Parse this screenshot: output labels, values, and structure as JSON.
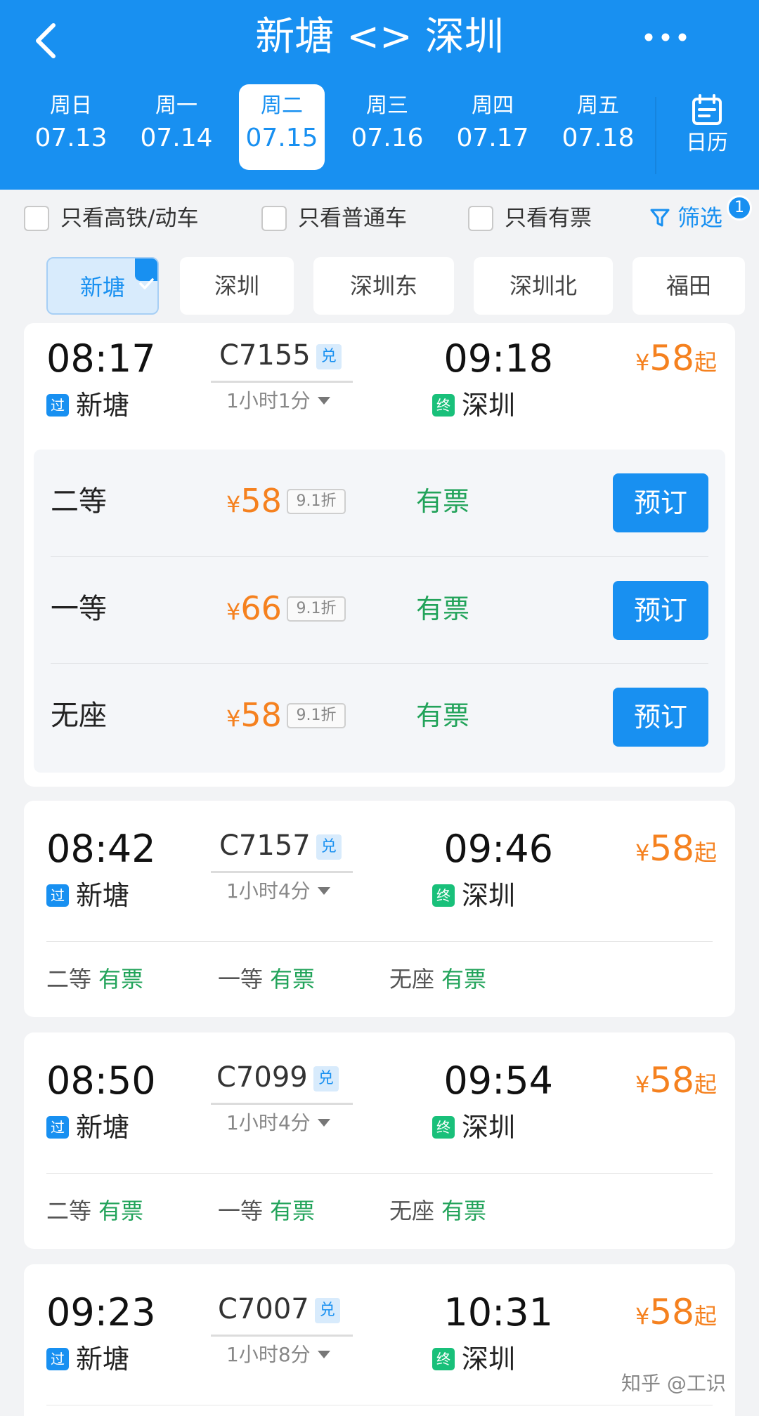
{
  "header": {
    "title": "新塘 <> 深圳",
    "back_icon": "chevron-left-icon",
    "more_icon": "more-dots-icon",
    "dates": [
      {
        "weekday": "周日",
        "date": "07.13"
      },
      {
        "weekday": "周一",
        "date": "07.14"
      },
      {
        "weekday": "周二",
        "date": "07.15"
      },
      {
        "weekday": "周三",
        "date": "07.16"
      },
      {
        "weekday": "周四",
        "date": "07.17"
      },
      {
        "weekday": "周五",
        "date": "07.18"
      }
    ],
    "selected_date": "07.15",
    "calendar_label": "日历"
  },
  "filters": {
    "options": [
      "只看高铁/动车",
      "只看普通车",
      "只看有票"
    ],
    "filter_label": "筛选",
    "filter_count": "1"
  },
  "stations": {
    "items": [
      "新塘",
      "深圳",
      "深圳东",
      "深圳北",
      "福田"
    ],
    "selected": "新塘"
  },
  "trains": [
    {
      "depart_time": "08:17",
      "train_no": "C7155",
      "badge": "兑",
      "arrive_time": "09:18",
      "duration": "1小时1分",
      "from_station": "新塘",
      "from_tag": "过",
      "to_station": "深圳",
      "to_tag": "终",
      "price_value": "58",
      "price_currency": "¥",
      "price_suffix": "起",
      "seats": [
        {
          "name": "二等",
          "price": "58",
          "currency": "¥",
          "discount": "9.1折",
          "status": "有票",
          "action": "预订"
        },
        {
          "name": "一等",
          "price": "66",
          "currency": "¥",
          "discount": "9.1折",
          "status": "有票",
          "action": "预订"
        },
        {
          "name": "无座",
          "price": "58",
          "currency": "¥",
          "discount": "9.1折",
          "status": "有票",
          "action": "预订"
        }
      ]
    },
    {
      "depart_time": "08:42",
      "train_no": "C7157",
      "badge": "兑",
      "arrive_time": "09:46",
      "duration": "1小时4分",
      "from_station": "新塘",
      "from_tag": "过",
      "to_station": "深圳",
      "to_tag": "终",
      "price_value": "58",
      "price_currency": "¥",
      "price_suffix": "起",
      "seats": [
        {
          "name": "二等",
          "status": "有票"
        },
        {
          "name": "一等",
          "status": "有票"
        },
        {
          "name": "无座",
          "status": "有票"
        }
      ]
    },
    {
      "depart_time": "08:50",
      "train_no": "C7099",
      "badge": "兑",
      "arrive_time": "09:54",
      "duration": "1小时4分",
      "from_station": "新塘",
      "from_tag": "过",
      "to_station": "深圳",
      "to_tag": "终",
      "price_value": "58",
      "price_currency": "¥",
      "price_suffix": "起",
      "seats": [
        {
          "name": "二等",
          "status": "有票"
        },
        {
          "name": "一等",
          "status": "有票"
        },
        {
          "name": "无座",
          "status": "有票"
        }
      ]
    },
    {
      "depart_time": "09:23",
      "train_no": "C7007",
      "badge": "兑",
      "arrive_time": "10:31",
      "duration": "1小时8分",
      "from_station": "新塘",
      "from_tag": "过",
      "to_station": "深圳",
      "to_tag": "终",
      "price_value": "58",
      "price_currency": "¥",
      "price_suffix": "起"
    }
  ],
  "watermark": "知乎 @工识",
  "colors": {
    "primary": "#1890f1",
    "price": "#f5811f",
    "available": "#22a35a",
    "end_tag": "#19c07a"
  }
}
